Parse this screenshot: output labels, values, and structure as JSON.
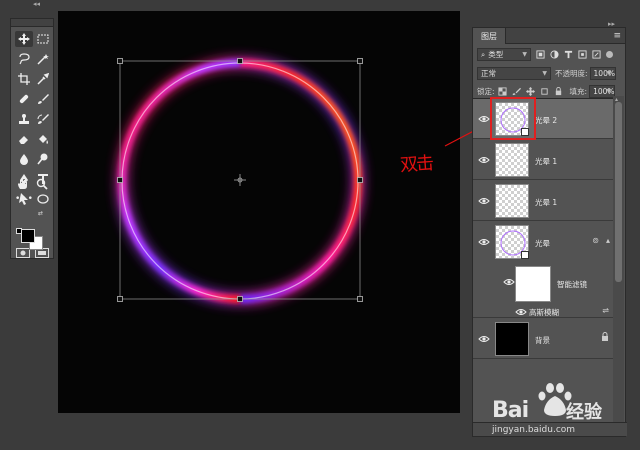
{
  "panel": {
    "tab_label": "图层",
    "filter_label": "类型",
    "blend_mode": "正常",
    "opacity_label": "不透明度:",
    "opacity_value": "100%",
    "lock_label": "锁定:",
    "fill_label": "填充:",
    "fill_value": "100%"
  },
  "layers": [
    {
      "name": "光晕 2",
      "selected": true
    },
    {
      "name": "光晕 1",
      "selected": false
    },
    {
      "name": "光晕 1",
      "selected": false
    },
    {
      "name": "光晕",
      "selected": false
    },
    {
      "name": "智能滤镜",
      "selected": false
    },
    {
      "name": "高斯模糊",
      "selected": false
    },
    {
      "name": "背景",
      "selected": false
    }
  ],
  "annotation": {
    "text": "双击",
    "color": "#e01010"
  },
  "watermark": {
    "brand": "Bai",
    "brand_cn": "经验",
    "url": "jingyan.baidu.com"
  },
  "colors": {
    "ring_red": "#ff1a1a",
    "ring_orange": "#ff8a00",
    "ring_purple": "#7b2bff",
    "ring_magenta": "#ff28c8",
    "highlight": "#e02020"
  },
  "icons": {
    "toolbar": [
      "move-icon",
      "marquee-icon",
      "lasso-icon",
      "magic-wand-icon",
      "crop-icon",
      "eyedropper-icon",
      "healing-icon",
      "brush-icon",
      "stamp-icon",
      "history-brush-icon",
      "eraser-icon",
      "bucket-icon",
      "blur-icon",
      "dodge-icon",
      "pen-icon",
      "type-icon",
      "path-select-icon",
      "ellipse-icon",
      "hand-icon",
      "zoom-icon"
    ]
  }
}
